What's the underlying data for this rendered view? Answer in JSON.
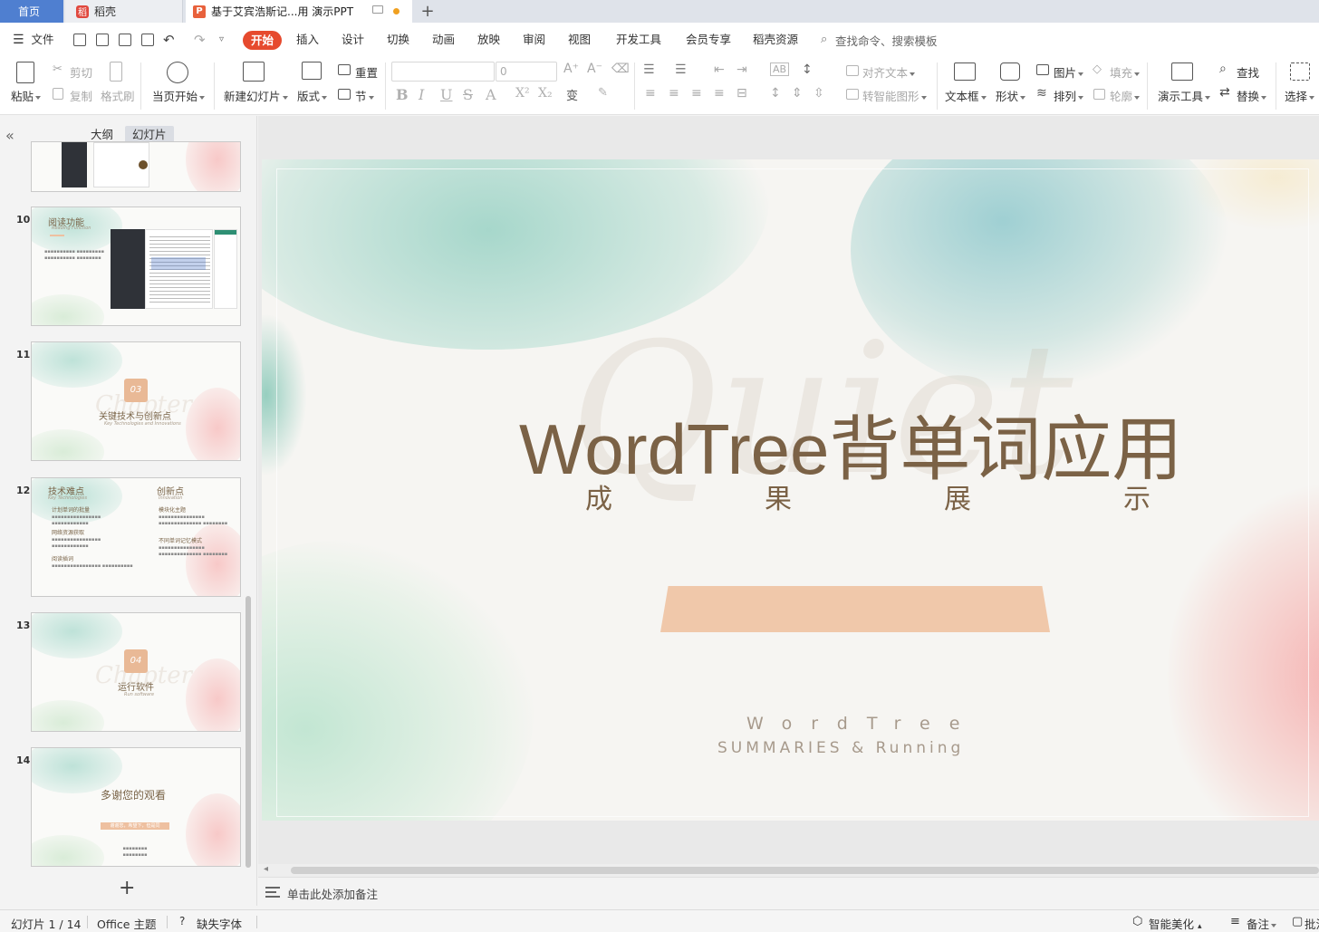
{
  "tabs": {
    "home": "首页",
    "daoke": "稻壳",
    "document": "基于艾宾浩斯记...用 演示PPT",
    "daoke_badge": "稻",
    "doc_badge": "P"
  },
  "menu": {
    "file": "文件",
    "items": [
      "开始",
      "插入",
      "设计",
      "切换",
      "动画",
      "放映",
      "审阅",
      "视图",
      "开发工具",
      "会员专享",
      "稻壳资源"
    ],
    "search_placeholder": "查找命令、搜索模板"
  },
  "ribbon": {
    "paste": "粘贴",
    "cut": "剪切",
    "copy": "复制",
    "format_painter": "格式刷",
    "play_from_current": "当页开始",
    "new_slide": "新建幻灯片",
    "layout": "版式",
    "reset": "重置",
    "section": "节",
    "font_name": "",
    "font_size": "0",
    "align_text": "对齐文本",
    "convert_smartart": "转智能图形",
    "textbox": "文本框",
    "shape": "形状",
    "picture": "图片",
    "arrange": "排列",
    "fill": "填充",
    "outline": "轮廓",
    "presentation_tools": "演示工具",
    "find": "查找",
    "replace": "替换",
    "select": "选择"
  },
  "panel": {
    "outline_tab": "大纲",
    "slides_tab": "幻灯片",
    "thumbnails": [
      {
        "number": "10",
        "title": "阅读功能",
        "subtitle": "Reading Function"
      },
      {
        "number": "11",
        "title": "关键技术与创新点",
        "badge": "03",
        "subtitle": "Key Technologies and Innovations",
        "ghost": "Chapter"
      },
      {
        "number": "12",
        "title_left": "技术难点",
        "title_right": "创新点",
        "sub_left": "Key Technologies",
        "sub_right": "Innovation",
        "items_left": [
          "计划单词的批量",
          "网络资源获取",
          "阅读插词"
        ],
        "items_right": [
          "模块化主题",
          "不同单词记忆模式"
        ]
      },
      {
        "number": "13",
        "title": "运行软件",
        "badge": "04",
        "subtitle": "Run software",
        "ghost": "Chapter"
      },
      {
        "number": "14",
        "title": "多谢您的观看",
        "band": "谢谢您，希望下，但是同"
      }
    ]
  },
  "slide": {
    "title": "WordTree背单词应用",
    "subtitle": "成果展示",
    "ghost_text": "Quiet",
    "line1": "WordTree",
    "line2": "SUMMARIES & Running"
  },
  "notes_placeholder": "单击此处添加备注",
  "status": {
    "slide_counter": "幻灯片 1 / 14",
    "theme": "Office 主题",
    "missing_font": "缺失字体",
    "smart_beautify": "智能美化",
    "notes": "备注",
    "comments": "批注"
  },
  "colors": {
    "accent": "#e64a2e",
    "title_brown": "#7b6246",
    "band_peach": "#f0c8aa",
    "home_tab": "#4f7fd0"
  }
}
